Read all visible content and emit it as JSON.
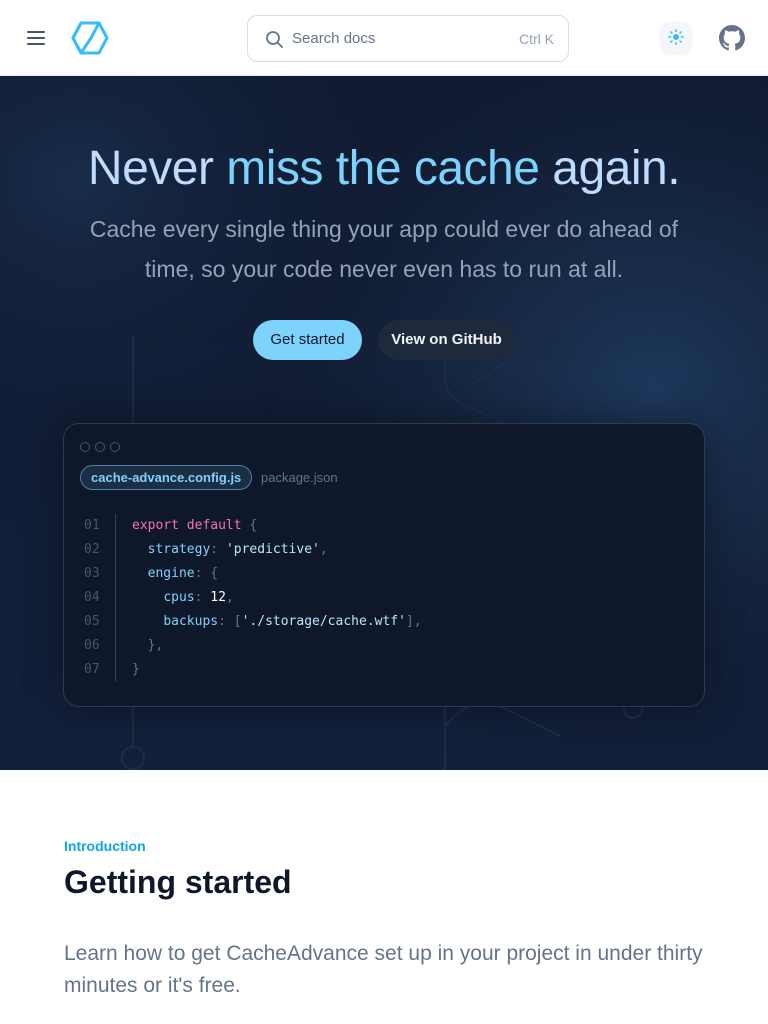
{
  "header": {
    "search_placeholder": "Search docs",
    "search_shortcut": "Ctrl K"
  },
  "hero": {
    "title_part1": "Never ",
    "title_accent": "miss the cache",
    "title_part2": " again.",
    "subtitle": "Cache every single thing your app could ever do ahead of time, so your code never even has to run at all.",
    "primary_button": "Get started",
    "secondary_button": "View on GitHub"
  },
  "code_window": {
    "tabs": [
      "cache-advance.config.js",
      "package.json"
    ],
    "line_numbers": [
      "01",
      "02",
      "03",
      "04",
      "05",
      "06",
      "07"
    ]
  },
  "content": {
    "eyebrow": "Introduction",
    "title": "Getting started",
    "lead": "Learn how to get CacheAdvance set up in your project in under thirty minutes or it's free."
  },
  "colors": {
    "accent": "#7dd3fc",
    "hero_bg": "#0f172a",
    "eyebrow": "#0ea5e9"
  },
  "icons": [
    "menu-icon",
    "logo-icon",
    "search-icon",
    "sun-icon",
    "github-icon"
  ]
}
